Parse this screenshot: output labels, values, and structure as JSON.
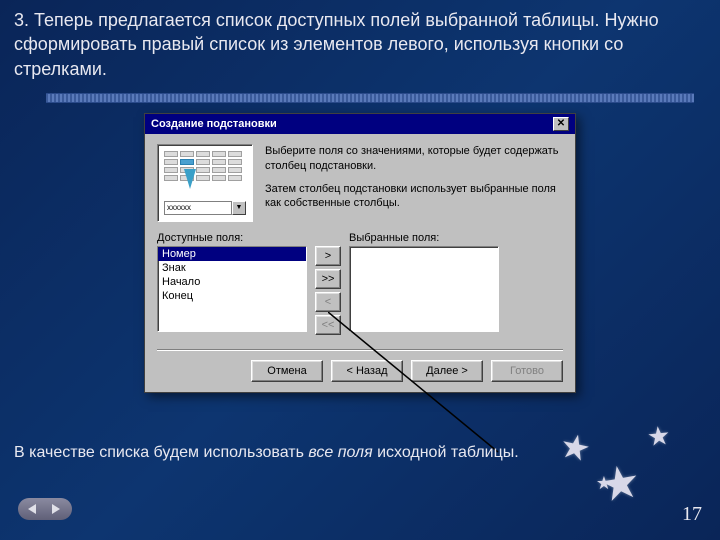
{
  "slide": {
    "top_text": "3. Теперь предлагается список доступных полей выбранной таблицы. Нужно сформировать правый список из элементов левого, используя кнопки со стрелками.",
    "bottom_text_before": "В качестве списка будем использовать ",
    "bottom_text_em": "все поля",
    "bottom_text_after": " исходной таблицы.",
    "page_number": "17"
  },
  "dialog": {
    "title": "Создание подстановки",
    "instruction1": "Выберите поля со значениями, которые будет содержать столбец подстановки.",
    "instruction2": "Затем столбец подстановки использует выбранные поля как собственные столбцы.",
    "available_label": "Доступные поля:",
    "selected_label": "Выбранные поля:",
    "available_items": [
      "Номер",
      "Знак",
      "Начало",
      "Конец"
    ],
    "btn_add": ">",
    "btn_add_all": ">>",
    "btn_remove": "<",
    "btn_remove_all": "<<",
    "btn_cancel": "Отмена",
    "btn_back": "< Назад",
    "btn_next": "Далее >",
    "btn_finish": "Готово",
    "preview_combo": "xxxxxx"
  }
}
